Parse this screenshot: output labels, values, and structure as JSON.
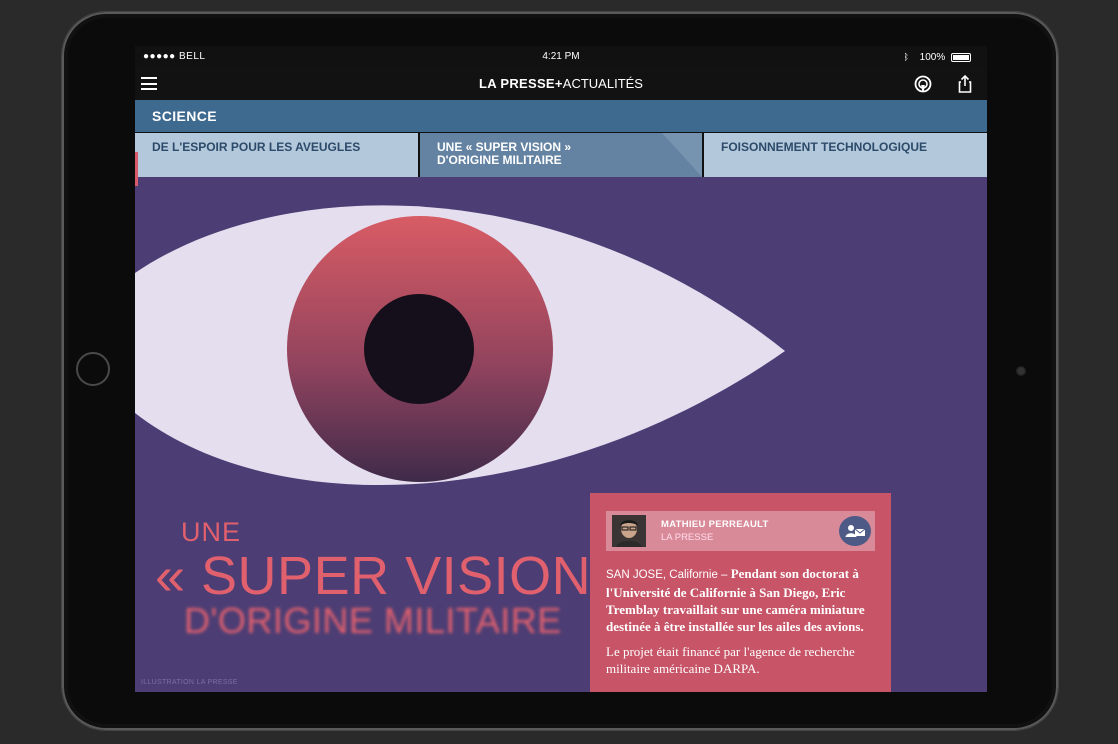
{
  "status_bar": {
    "carrier": "●●●●● BELL",
    "time": "4:21 PM",
    "battery": "100%"
  },
  "nav": {
    "brand": "LA PRESSE+",
    "section": "ACTUALITÉS",
    "icons": [
      "menu-icon",
      "podcast-icon",
      "share-icon"
    ]
  },
  "section_title": "SCIENCE",
  "tabs": [
    {
      "line1": "DE L'ESPOIR POUR LES AVEUGLES",
      "line2": ""
    },
    {
      "line1": "UNE « SUPER VISION »",
      "line2": "D'ORIGINE MILITAIRE"
    },
    {
      "line1": "FOISONNEMENT TECHNOLOGIQUE",
      "line2": ""
    }
  ],
  "headline": {
    "line1": "UNE",
    "line2": "« SUPER VISION »",
    "line3": "D'ORIGINE MILITAIRE"
  },
  "illustration_credit": "ILLUSTRATION LA PRESSE",
  "article": {
    "author_name": "MATHIEU PERREAULT",
    "author_org": "LA PRESSE",
    "dateline": "SAN JOSE, Californie –",
    "lead": "Pendant son doctorat à l'Université de Californie à San Diego, Eric Tremblay travaillait sur une caméra miniature destinée à être installée sur les ailes des avions.",
    "paragraph2": "Le projet était financé par l'agence de recherche militaire américaine DARPA."
  },
  "colors": {
    "section_bar": "#3f6a90",
    "tab_inactive": "#b3c8da",
    "tab_active": "#6483a2",
    "background_purple": "#4c3e74",
    "accent_red": "#e0606e",
    "card": "#c75467"
  }
}
